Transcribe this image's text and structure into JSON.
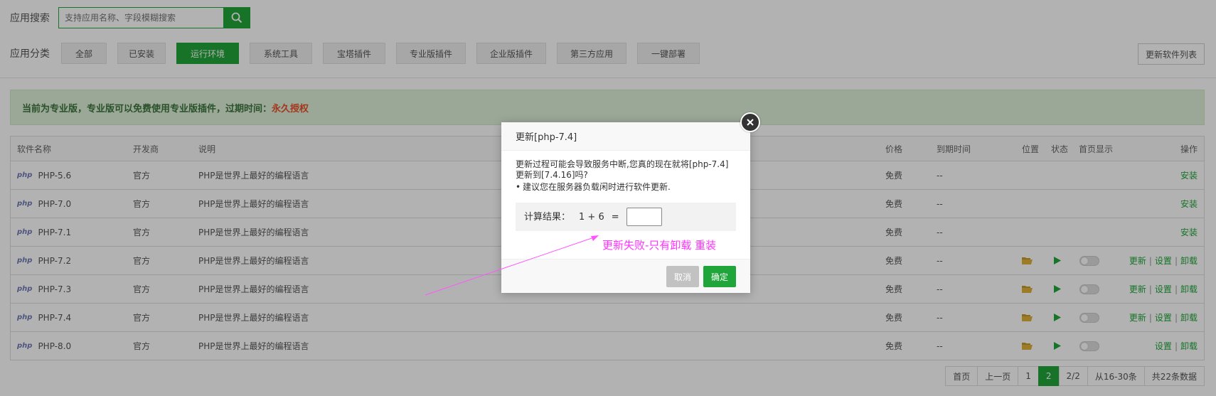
{
  "search": {
    "label": "应用搜索",
    "placeholder": "支持应用名称、字段模糊搜索"
  },
  "categories": {
    "label": "应用分类",
    "items": [
      "全部",
      "已安装",
      "运行环境",
      "系统工具",
      "宝塔插件",
      "专业版插件",
      "企业版插件",
      "第三方应用",
      "一键部署"
    ],
    "active": "运行环境",
    "refresh_label": "更新软件列表"
  },
  "notice": {
    "text": "当前为专业版，专业版可以免费使用专业版插件，过期时间：",
    "permanent": "永久授权"
  },
  "table": {
    "headers": {
      "name": "软件名称",
      "developer": "开发商",
      "desc": "说明",
      "price": "价格",
      "expire": "到期时间",
      "location": "位置",
      "status": "状态",
      "homepage": "首页显示",
      "ops": "操作"
    },
    "php_logo": "php",
    "rows": [
      {
        "name": "PHP-5.6",
        "developer": "官方",
        "desc": "PHP是世界上最好的编程语言",
        "price": "免费",
        "expire": "--",
        "installed": false,
        "ops": [
          "安装"
        ]
      },
      {
        "name": "PHP-7.0",
        "developer": "官方",
        "desc": "PHP是世界上最好的编程语言",
        "price": "免费",
        "expire": "--",
        "installed": false,
        "ops": [
          "安装"
        ]
      },
      {
        "name": "PHP-7.1",
        "developer": "官方",
        "desc": "PHP是世界上最好的编程语言",
        "price": "免费",
        "expire": "--",
        "installed": false,
        "ops": [
          "安装"
        ]
      },
      {
        "name": "PHP-7.2",
        "developer": "官方",
        "desc": "PHP是世界上最好的编程语言",
        "price": "免费",
        "expire": "--",
        "installed": true,
        "ops": [
          "更新",
          "设置",
          "卸载"
        ]
      },
      {
        "name": "PHP-7.3",
        "developer": "官方",
        "desc": "PHP是世界上最好的编程语言",
        "price": "免费",
        "expire": "--",
        "installed": true,
        "ops": [
          "更新",
          "设置",
          "卸载"
        ]
      },
      {
        "name": "PHP-7.4",
        "developer": "官方",
        "desc": "PHP是世界上最好的编程语言",
        "price": "免费",
        "expire": "--",
        "installed": true,
        "ops": [
          "更新",
          "设置",
          "卸载"
        ]
      },
      {
        "name": "PHP-8.0",
        "developer": "官方",
        "desc": "PHP是世界上最好的编程语言",
        "price": "免费",
        "expire": "--",
        "installed": true,
        "ops": [
          "设置",
          "卸载"
        ]
      }
    ]
  },
  "pagination": {
    "first": "首页",
    "prev": "上一页",
    "pages": [
      "1",
      "2"
    ],
    "current": "2",
    "total_pages": "2/2",
    "range": "从16-30条",
    "total": "共22条数据"
  },
  "modal": {
    "title": "更新[php-7.4]",
    "message": "更新过程可能会导致服务中断,您真的现在就将[php-7.4]更新到[7.4.16]吗?",
    "tip": "建议您在服务器负载闲时进行软件更新.",
    "calc_label": "计算结果：",
    "calc_expr": "1 + 6",
    "calc_eq": "=",
    "cancel_label": "取消",
    "ok_label": "确定"
  },
  "annotation": {
    "text": "更新失败-只有卸载 重装",
    "color": "#ff33ff"
  },
  "colors": {
    "accent": "#20a53a",
    "permanent": "#e8502a",
    "folder": "#e0b23a"
  }
}
